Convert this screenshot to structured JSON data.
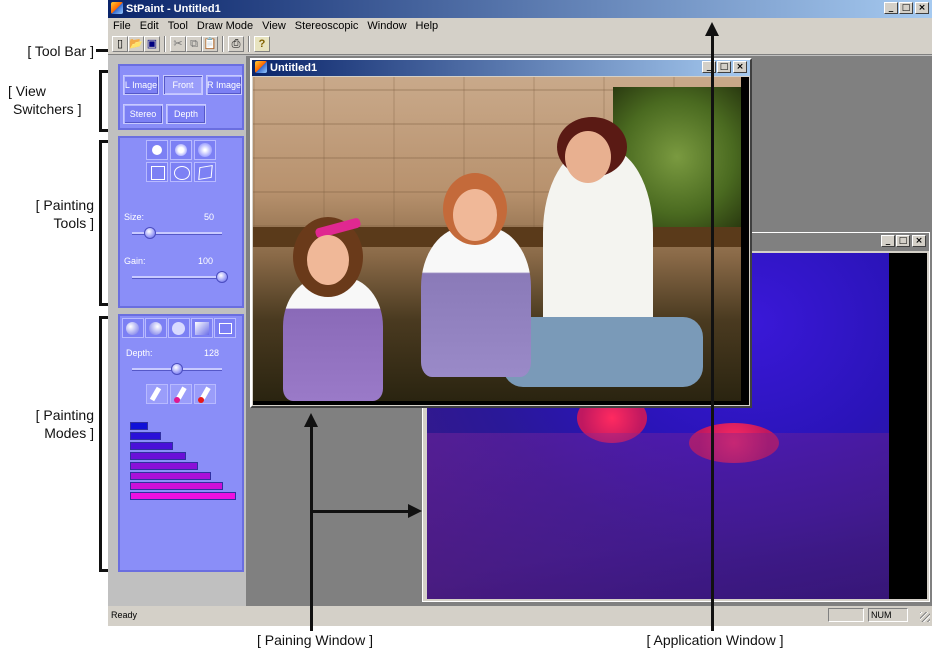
{
  "annotations": {
    "tool_bar": "[ Tool Bar ]",
    "view_switchers_1": "[ View",
    "view_switchers_2": "Switchers ]",
    "painting_tools_1": "[ Painting",
    "painting_tools_2": "Tools ]",
    "painting_modes_1": "[ Painting",
    "painting_modes_2": "Modes ]",
    "painting_window": "[ Paining Window ]",
    "application_window": "[ Application Window ]"
  },
  "app": {
    "title": "StPaint - Untitled1",
    "window_buttons": [
      "_",
      "□",
      "×"
    ]
  },
  "menu": [
    "File",
    "Edit",
    "Tool",
    "Draw Mode",
    "View",
    "Stereoscopic",
    "Window",
    "Help"
  ],
  "toolbar": {
    "icons": [
      "new-icon",
      "open-icon",
      "save-icon",
      "cut-icon",
      "copy-icon",
      "paste-icon",
      "print-icon",
      "help-icon"
    ],
    "glyphs": [
      "▯",
      "📂",
      "▣",
      "✂",
      "⧉",
      "📋",
      "⎙",
      "?"
    ]
  },
  "view_switchers": {
    "l_image": "L Image",
    "front": "Front",
    "r_image": "R Image",
    "stereo": "Stereo",
    "depth": "Depth",
    "active": "Front"
  },
  "painting_tools": {
    "size_label": "Size:",
    "size_value": "50",
    "size_fraction": 0.2,
    "gain_label": "Gain:",
    "gain_value": "100",
    "gain_fraction": 1.0
  },
  "painting_modes": {
    "depth_label": "Depth:",
    "depth_value": "128",
    "depth_fraction": 0.5,
    "color_bars": [
      "#1010d8",
      "#2a10d8",
      "#4a10d8",
      "#6a10d8",
      "#8a10d8",
      "#aa10d8",
      "#cc10d8",
      "#ee10e0"
    ]
  },
  "doc_window": {
    "title": "Untitled1",
    "window_buttons": [
      "_",
      "□",
      "×"
    ]
  },
  "depth_window": {
    "window_buttons": [
      "_",
      "□",
      "×"
    ]
  },
  "status": {
    "ready": "Ready",
    "num": "NUM"
  }
}
